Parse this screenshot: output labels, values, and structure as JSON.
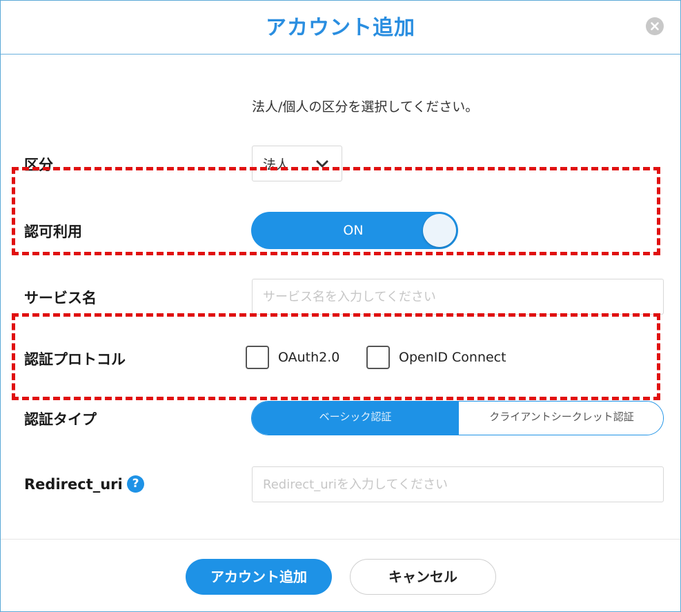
{
  "dialog": {
    "title": "アカウント追加",
    "close_icon": "close-icon",
    "instruction": "法人/個人の区分を選択してください。"
  },
  "form": {
    "category": {
      "label": "区分",
      "value": "法人",
      "icon": "chevron-down-icon"
    },
    "authorization": {
      "label": "認可利用",
      "toggle_text": "ON",
      "on": true
    },
    "service_name": {
      "label": "サービス名",
      "placeholder": "サービス名を入力してください",
      "value": ""
    },
    "auth_protocol": {
      "label": "認証プロトコル",
      "options": [
        {
          "label": "OAuth2.0",
          "checked": false
        },
        {
          "label": "OpenID Connect",
          "checked": false
        }
      ]
    },
    "auth_type": {
      "label": "認証タイプ",
      "options": [
        {
          "label": "ベーシック認証",
          "selected": true
        },
        {
          "label": "クライアントシークレット認証",
          "selected": false
        }
      ]
    },
    "redirect_uri": {
      "label": "Redirect_uri",
      "help_icon": "?",
      "placeholder": "Redirect_uriを入力してください",
      "value": ""
    }
  },
  "footer": {
    "submit_label": "アカウント追加",
    "cancel_label": "キャンセル"
  },
  "colors": {
    "accent": "#1e92e6",
    "title": "#2a8ee0",
    "highlight": "#e01010"
  }
}
